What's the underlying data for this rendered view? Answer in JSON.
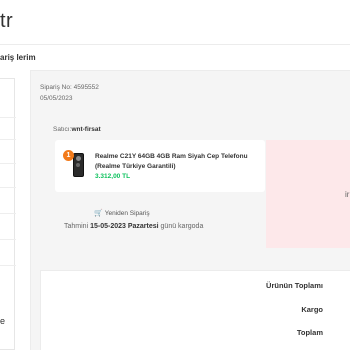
{
  "header": {
    "logo_fragment": "tr"
  },
  "breadcrumb": {
    "label": "ariş lerim"
  },
  "sidebar": {
    "fragment": "e"
  },
  "order": {
    "number": "Sipariş No: 4595552",
    "date": "05/05/2023",
    "seller_prefix": "Satıcı:",
    "seller_name": "wnt-firsat"
  },
  "product": {
    "badge": "1",
    "name": "Realme C21Y 64GB 4GB Ram Siyah Cep Telefonu (Realme Türkiye Garantili)",
    "price": "3.312,00 TL"
  },
  "actions": {
    "reorder": "Yeniden Sipariş",
    "reorder_icon": "cart-icon"
  },
  "delivery": {
    "prefix": "Tahmini",
    "date": "15-05-2023 Pazartesi",
    "suffix": "günü kargoda"
  },
  "status": {
    "fragment": "ir"
  },
  "summary": {
    "items_total": "Ürünün Toplamı",
    "shipping": "Kargo",
    "total": "Toplam"
  },
  "colors": {
    "accent": "#f27a1a",
    "price_green": "#0bc15c",
    "status_bg": "#fde8ea"
  }
}
